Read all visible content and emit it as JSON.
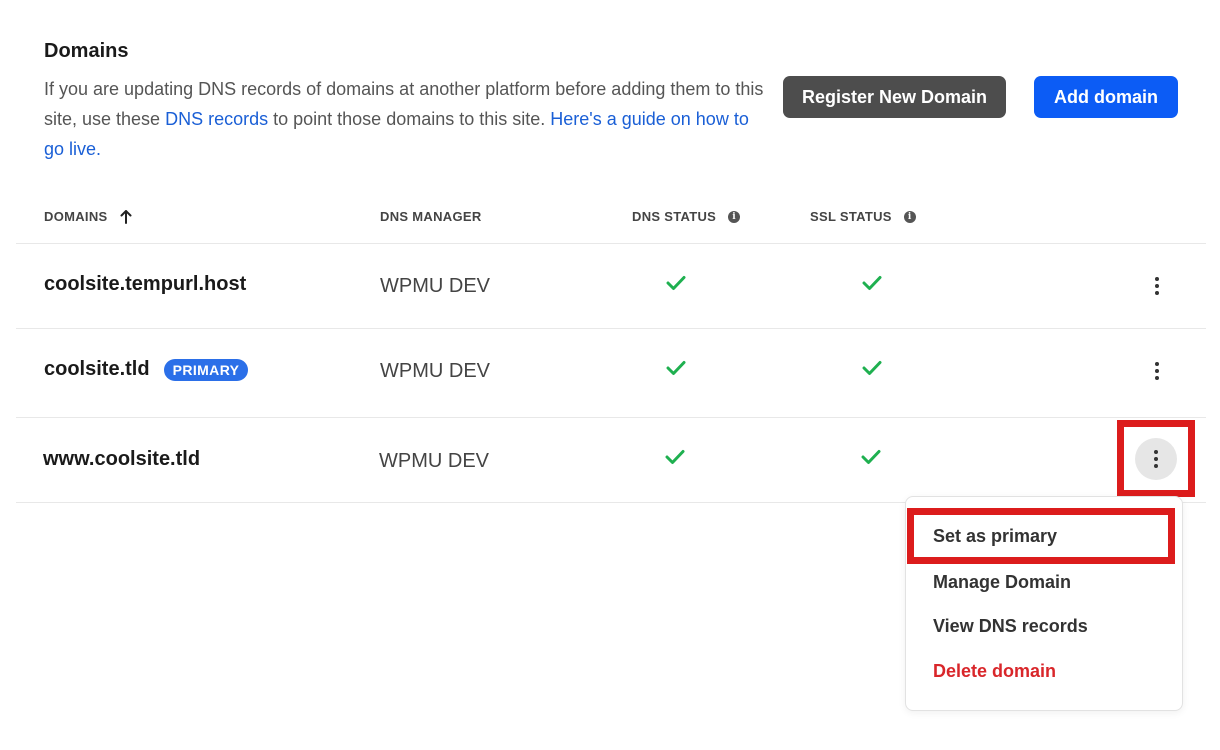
{
  "header": {
    "title": "Domains",
    "description_pre": "If you are updating DNS records of domains at another platform before adding them to this site, use these ",
    "dns_records_link": "DNS records",
    "description_mid": " to point those domains to this site. ",
    "guide_link": "Here's a guide on how to go live.",
    "register_button": "Register New Domain",
    "add_button": "Add domain"
  },
  "table": {
    "columns": {
      "domains": "DOMAINS",
      "dns_manager": "DNS MANAGER",
      "dns_status": "DNS STATUS",
      "ssl_status": "SSL STATUS"
    },
    "sort_icon": "arrow-up-icon",
    "info_icon": "info-icon",
    "rows": [
      {
        "domain": "coolsite.tempurl.host",
        "badge": "",
        "dns_manager": "WPMU DEV",
        "dns_status": "ok",
        "ssl_status": "ok"
      },
      {
        "domain": "coolsite.tld",
        "badge": "PRIMARY",
        "dns_manager": "WPMU DEV",
        "dns_status": "ok",
        "ssl_status": "ok"
      },
      {
        "domain": "www.coolsite.tld",
        "badge": "",
        "dns_manager": "WPMU DEV",
        "dns_status": "ok",
        "ssl_status": "ok"
      }
    ]
  },
  "menu": {
    "items": [
      "Set as primary",
      "Manage Domain",
      "View DNS records",
      "Delete domain"
    ]
  },
  "colors": {
    "accent": "#0c5cf5",
    "link": "#1a5fd6",
    "success": "#1fb050",
    "danger": "#d9262a",
    "highlight": "#dc1c1c"
  }
}
